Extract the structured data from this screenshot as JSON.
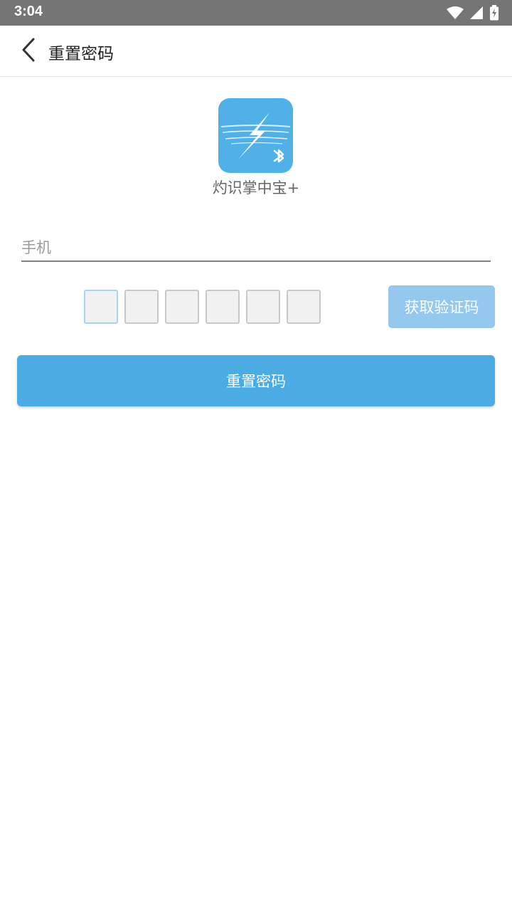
{
  "status_bar": {
    "time": "3:04",
    "icons": [
      "wifi-icon",
      "signal-icon",
      "battery-charging-icon"
    ]
  },
  "app_bar": {
    "back_icon": "chevron-left-icon",
    "title": "重置密码"
  },
  "logo": {
    "app_name": "灼识掌中宝+",
    "icon": "lightning-bluetooth-logo-icon",
    "color": "#4fb1e8"
  },
  "form": {
    "phone_placeholder": "手机",
    "phone_value": "",
    "code_digits": [
      "",
      "",
      "",
      "",
      "",
      ""
    ],
    "get_code_label": "获取验证码",
    "submit_label": "重置密码"
  },
  "colors": {
    "accent": "#4aace3",
    "accent_disabled": "#95c8ee",
    "status_bar": "#757575"
  }
}
